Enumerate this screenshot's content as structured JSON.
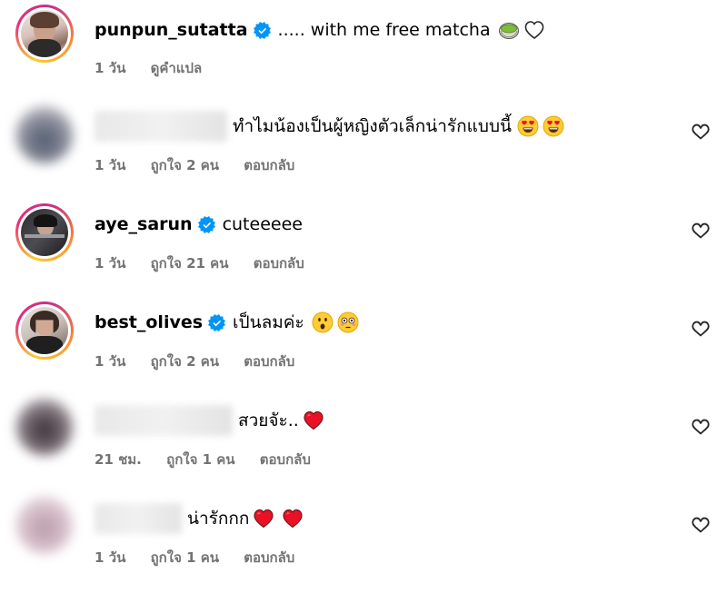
{
  "caption": {
    "username": "punpun_sutatta",
    "text": "..... with me free matcha",
    "time": "1 วัน",
    "translate": "ดูคำแปล"
  },
  "comments": [
    {
      "username": "",
      "text": "ทำไมน้องเป็นผู้หญิงตัวเล็กน่ารักแบบนี้",
      "time": "1 วัน",
      "likes": "ถูกใจ 2 คน",
      "reply": "ตอบกลับ"
    },
    {
      "username": "aye_sarun",
      "text": "cuteeeee",
      "time": "1 วัน",
      "likes": "ถูกใจ 21 คน",
      "reply": "ตอบกลับ"
    },
    {
      "username": "best_olives",
      "text": "เป็นลมค่ะ",
      "time": "1 วัน",
      "likes": "ถูกใจ 2 คน",
      "reply": "ตอบกลับ"
    },
    {
      "username": "",
      "text": "สวยจัะ..",
      "time": "21 ชม.",
      "likes": "ถูกใจ 1 คน",
      "reply": "ตอบกลับ"
    },
    {
      "username": "",
      "text": "น่ารักกก",
      "time": "1 วัน",
      "likes": "ถูกใจ 1 คน",
      "reply": "ตอบกลับ"
    }
  ],
  "icons": {
    "verified": "verified-badge-icon",
    "like": "heart-outline-icon",
    "matcha": "matcha-emoji",
    "white_heart": "white-heart-emoji",
    "heart_eyes": "heart-eyes-emoji",
    "astonished": "astonished-emoji",
    "flushed": "flushed-emoji",
    "red_heart": "red-heart-emoji"
  },
  "colors": {
    "verified": "#0095f6",
    "meta_text": "#737373",
    "story_ring": "#ee2a7b"
  }
}
